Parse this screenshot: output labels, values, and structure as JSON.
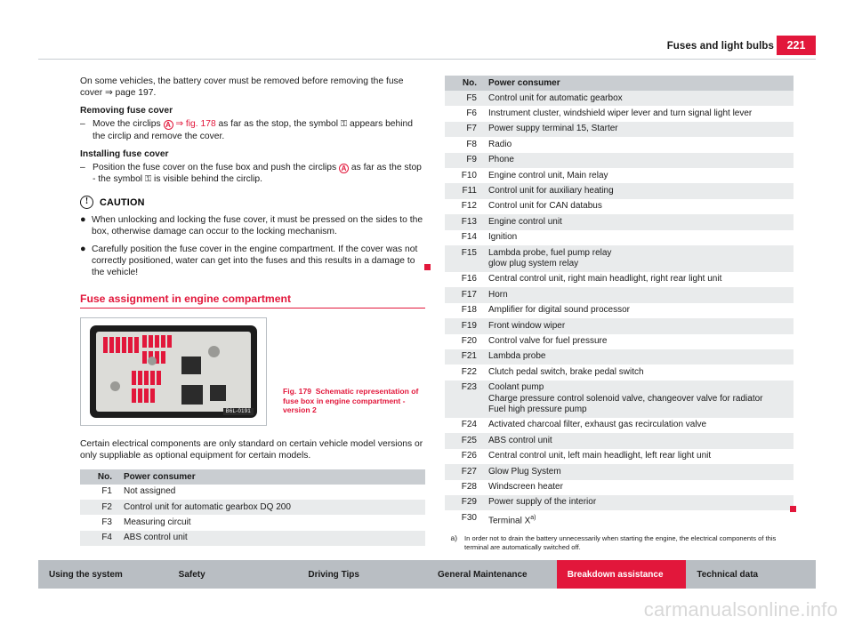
{
  "header": {
    "title": "Fuses and light bulbs",
    "page_number": "221"
  },
  "left": {
    "intro": "On some vehicles, the battery cover must be removed before removing the fuse cover ⇒ page 197.",
    "removing_head": "Removing fuse cover",
    "removing_item_pre": "Move the circlips ",
    "removing_item_a": "A",
    "removing_item_ref": " ⇒ fig. 178 ",
    "removing_item_mid": "as far as the stop, the symbol ",
    "removing_item_sym": "⚿",
    "removing_item_post": " appears behind the circlip and remove the cover.",
    "installing_head": "Installing fuse cover",
    "installing_pre": "Position the fuse cover on the fuse box and push the circlips ",
    "installing_a": "A",
    "installing_mid": " as far as the stop - the symbol ",
    "installing_sym": "⚿",
    "installing_post": " is visible behind the circlip.",
    "caution_title": "CAUTION",
    "caution_icon": "!",
    "caution_1": "When unlocking and locking the fuse cover, it must be pressed on the sides to the box, otherwise damage can occur to the locking mechanism.",
    "caution_2": "Carefully position the fuse cover in the engine compartment. If the cover was not correctly positioned, water can get into the fuses and this results in a damage to the vehicle!",
    "section_title": "Fuse assignment in engine compartment",
    "fig_label": "Fig. 179",
    "fig_caption": "Schematic representation of fuse box in engine compartment - version 2",
    "fig_code": "B6L-0191",
    "after_fig": "Certain electrical components are only standard on certain vehicle model versions or only suppliable as optional equipment for certain models.",
    "table": {
      "headers": [
        "No.",
        "Power consumer"
      ],
      "rows": [
        [
          "F1",
          "Not assigned"
        ],
        [
          "F2",
          "Control unit for automatic gearbox DQ 200"
        ],
        [
          "F3",
          "Measuring circuit"
        ],
        [
          "F4",
          "ABS control unit"
        ]
      ]
    }
  },
  "right": {
    "table": {
      "headers": [
        "No.",
        "Power consumer"
      ],
      "rows": [
        [
          "F5",
          "Control unit for automatic gearbox"
        ],
        [
          "F6",
          "Instrument cluster, windshield wiper lever and turn signal light lever"
        ],
        [
          "F7",
          "Power suppy terminal 15, Starter"
        ],
        [
          "F8",
          "Radio"
        ],
        [
          "F9",
          "Phone"
        ],
        [
          "F10",
          "Engine control unit, Main relay"
        ],
        [
          "F11",
          "Control unit for auxiliary heating"
        ],
        [
          "F12",
          "Control unit for CAN databus"
        ],
        [
          "F13",
          "Engine control unit"
        ],
        [
          "F14",
          "Ignition"
        ],
        [
          "F15",
          "Lambda probe, fuel pump relay\nglow plug system relay"
        ],
        [
          "F16",
          "Central control unit, right main headlight, right rear light unit"
        ],
        [
          "F17",
          "Horn"
        ],
        [
          "F18",
          "Amplifier for digital sound processor"
        ],
        [
          "F19",
          "Front window wiper"
        ],
        [
          "F20",
          "Control valve for fuel pressure"
        ],
        [
          "F21",
          "Lambda probe"
        ],
        [
          "F22",
          "Clutch pedal switch, brake pedal switch"
        ],
        [
          "F23",
          "Coolant pump\nCharge pressure control solenoid valve, changeover valve for radiator\nFuel high pressure pump"
        ],
        [
          "F24",
          "Activated charcoal filter, exhaust gas recirculation valve"
        ],
        [
          "F25",
          "ABS control unit"
        ],
        [
          "F26",
          "Central control unit, left main headlight, left rear light unit"
        ],
        [
          "F27",
          "Glow Plug System"
        ],
        [
          "F28",
          "Windscreen heater"
        ],
        [
          "F29",
          "Power supply of the interior"
        ],
        [
          "F30",
          "Terminal X a)"
        ]
      ]
    },
    "footnote_mark": "a)",
    "footnote_text": "In order not to drain the battery unnecessarily when starting the engine, the electrical components of this terminal are automatically switched off."
  },
  "footer": {
    "items": [
      {
        "label": "Using the system",
        "active": false
      },
      {
        "label": "Safety",
        "active": false
      },
      {
        "label": "Driving Tips",
        "active": false
      },
      {
        "label": "General Maintenance",
        "active": false
      },
      {
        "label": "Breakdown assistance",
        "active": true
      },
      {
        "label": "Technical data",
        "active": false
      }
    ]
  },
  "watermark": "carmanualsonline.info",
  "colors": {
    "accent": "#e2173b",
    "header_band": "#c9cdd1",
    "row_alt": "#e9ebec",
    "footer": "#b9bec3"
  }
}
